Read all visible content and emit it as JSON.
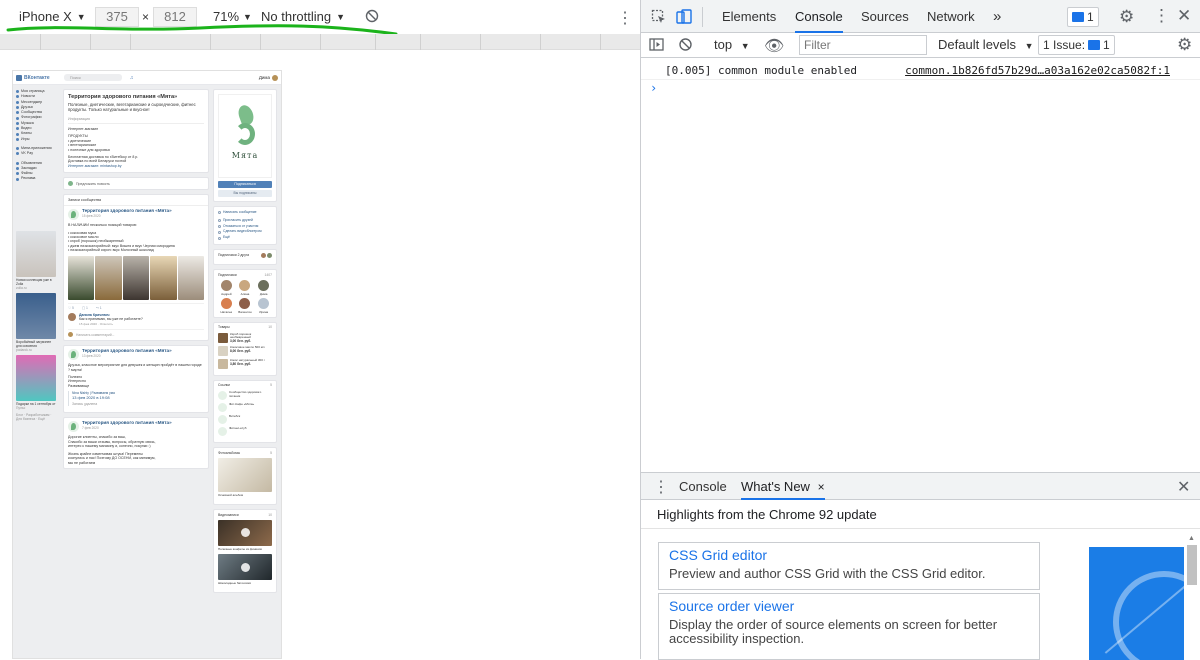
{
  "device_toolbar": {
    "device": "iPhone X",
    "width": "375",
    "times": "×",
    "height": "812",
    "zoom": "71%",
    "throttling": "No throttling",
    "chevron": "▼",
    "rotate_icon": "rotate-icon",
    "more_icon": "⋮"
  },
  "vk": {
    "logo_text": "ВКонтакте",
    "search_placeholder": "Поиск",
    "user_name": "Дима",
    "nav": [
      "Моя страница",
      "Новости",
      "Мессенджер",
      "Друзья",
      "Сообщества",
      "Фотографии",
      "Музыка",
      "Видео",
      "Клипы",
      "Игры",
      "Мини-приложения",
      "VK Pay",
      "Объявления",
      "Закладки",
      "Файлы",
      "Реклама"
    ],
    "ads": [
      {
        "caption": "Новая коллекция уже в Zolla",
        "source": "zolla.ru"
      },
      {
        "caption": "Воробьёвый загрязнен для освоения",
        "source": "podarok.ru"
      },
      {
        "caption": "Подарки на 1 сентября от",
        "source": "Пульс"
      }
    ],
    "footer": "Блог · Разработчикам · Для бизнеса · Ещё",
    "group": {
      "title": "Территория здорового питания «Мята»",
      "status": "Полезные, диетические, вегетарианские и сыроедческие, фитнес продукты. Только натуральные и вкусное!",
      "section": "Информация",
      "lines": [
        "Интернет-магазин",
        "",
        "ПРОДУКТЫ",
        "• диетические",
        "• вегетарианские",
        "• полезные для здоровья",
        "",
        "Бесплатная доставка по г.Витебску от 8 р.",
        "Доставка по всей Беларуси почтой",
        "Интернет-магазин: mintashop.by"
      ]
    },
    "suggest": "Предложить новость",
    "wall_tab": "Записи сообщества",
    "post1": {
      "name": "Территория здорового питания «Мята»",
      "date": "15 фев 2020",
      "lines": [
        "В НАЛИЧИИ несколько позиций товаров:",
        "",
        "• кокосовая мука",
        "• кокосовое масло",
        "• кэроб (порошок) необжаренный",
        "• джем низкокалорийный: вкус Вишня и вкус Черная смородина",
        "• низкокалорийный сироп: вкус Молочный шоколад"
      ],
      "likes": "5",
      "comments": "1",
      "shares": "1",
      "comment_name": "Данила Кричевич",
      "comment_text": "Как я принимаю, вы уже не работаете?",
      "comment_date": "15 фев 2020 · Ответить",
      "comment_input": "Написать комментарий..."
    },
    "post2": {
      "name": "Территория здорового питания «Мята»",
      "date": "13 фев 2020",
      "lines": [
        "Друзья, классное мероприятие для девушек и женщин пройдёт в нашем городе ? марта!",
        "",
        "Полезно",
        "Интересно",
        "Развивающе"
      ],
      "repost_name": "Nina Nishty | Развиваем ума",
      "repost_date": "13 фев 2020 в 19:08",
      "deleted": "Запись удалена"
    },
    "post3": {
      "name": "Территория здорового питания «Мята»",
      "date": "7 фев 2020",
      "lines": [
        "Дорогие клиенты, спасибо за ваш,",
        "Спасибо за ваши отзывы, вопросы, обратную связь,",
        "интерес к нашему магазину и, конечно, покупки :)",
        "",
        "Жизнь крайне изменчивая штука! Перемены",
        "коснулись и нас! Поэтому ДО ОСЕНИ, как минимум,",
        "мы не работаем"
      ]
    },
    "brand": "Мята",
    "btn_join": "Подписаться",
    "btn_subscribed": "Вы подписаны",
    "menu": [
      "Написать сообщение",
      "Пригласить друзей",
      "Отказаться от участия",
      "Сделать видеоблогером",
      "Ещё"
    ],
    "friends_block": "Подписчики 2 друга",
    "members_title": "Подписчики",
    "members_count": "1407",
    "members": [
      "Андрей",
      "Алёна",
      "Дима",
      "Наталья",
      "Валентин",
      "Ирина"
    ],
    "goods_title": "Товары",
    "goods_count": "10",
    "goods": [
      {
        "name": "Кэроб порошок необжаренный",
        "price": "3,00 бел. руб."
      },
      {
        "name": "Кокосовое масло 500 мл",
        "price": "8,00 бел. руб."
      },
      {
        "name": "Кокос натуральный 300 г",
        "price": "3,80 бел. руб."
      }
    ],
    "links_title": "Ссылки",
    "links_count": "5",
    "links": [
      "Сообщество здорового питания",
      "Фит-Кафе «Мята»",
      "Витебск",
      "Фитнес-клуб"
    ],
    "albums_title": "Фотоальбомы",
    "albums_count": "5",
    "album_caption": "Основной альбом",
    "videos_title": "Видеозаписи",
    "videos_count": "10",
    "video_captions": [
      "Полезные конфеты из фиников",
      "Шоколадные батончики"
    ]
  },
  "devtools": {
    "tabs": [
      "Elements",
      "Console",
      "Sources",
      "Network"
    ],
    "active_tab": "Console",
    "more_tabs": "»",
    "issues_count": "1",
    "context": "top",
    "filter_placeholder": "Filter",
    "levels": "Default levels",
    "issues_label": "1 Issue:",
    "issues_badge": "1",
    "log_message": "[0.005]  common module enabled",
    "log_source": "common.1b826fd57b29d…a03a162e02ca5082f:1",
    "prompt": "›",
    "drawer_tabs": [
      "Console",
      "What's New"
    ],
    "drawer_close": "×",
    "highlights": "Highlights from the Chrome 92 update",
    "features": [
      {
        "title": "CSS Grid editor",
        "desc": "Preview and author CSS Grid with the CSS Grid editor."
      },
      {
        "title": "Source order viewer",
        "desc": "Display the order of source elements on screen for better accessibility inspection."
      }
    ]
  },
  "colors": {
    "vk_blue": "#4a76a8",
    "devtools_blue": "#1a73e8",
    "annotation_green": "#1bb31b",
    "mint_green": "#6fb27f"
  }
}
